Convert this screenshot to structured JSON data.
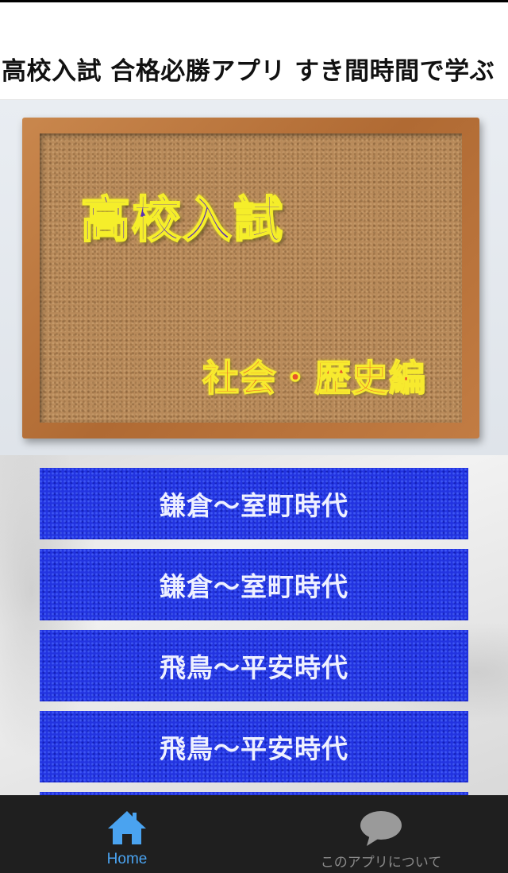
{
  "header": {
    "title": "高校入試 合格必勝アプリ すき間時間で学ぶ"
  },
  "hero": {
    "title": "高校入試",
    "subtitle": "社会・歴史編"
  },
  "menu": {
    "items": [
      {
        "label": "鎌倉〜室町時代"
      },
      {
        "label": "鎌倉〜室町時代"
      },
      {
        "label": "飛鳥〜平安時代"
      },
      {
        "label": "飛鳥〜平安時代"
      }
    ]
  },
  "tabbar": {
    "home_label": "Home",
    "about_label": "このアプリについて",
    "home_icon": "home-icon",
    "about_icon": "chat-bubble-icon",
    "active_color": "#4aa3f0",
    "inactive_color": "#8a8a8a"
  },
  "colors": {
    "button_blue": "#2233e0",
    "tabbar_bg": "#1f1f1f"
  }
}
